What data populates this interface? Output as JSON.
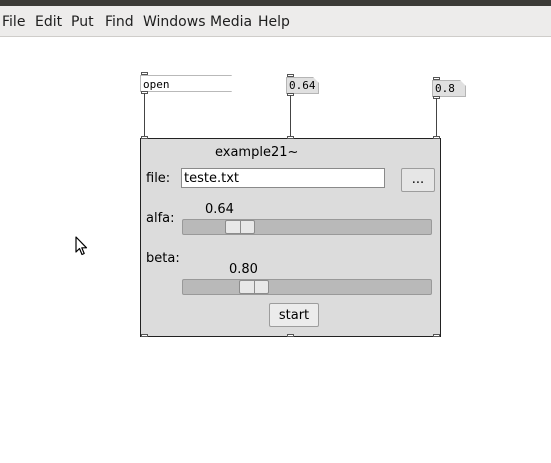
{
  "menubar": {
    "items": [
      "File",
      "Edit",
      "Put",
      "Find",
      "Windows",
      "Media",
      "Help"
    ]
  },
  "canvas": {
    "message_box": "open teste.txt",
    "number_box_1": "0.64",
    "number_box_2": "0.8"
  },
  "gop": {
    "title": "example21~",
    "file_label": "file:",
    "file_value": "teste.txt",
    "browse_label": "...",
    "alfa_label": "alfa:",
    "alfa_value_text": "0.64",
    "alfa_value": 0.64,
    "beta_label": "beta:",
    "beta_value_text": "0.80",
    "beta_value": 0.8,
    "start_label": "start"
  },
  "icons": {
    "cursor": "mouse-pointer-icon"
  },
  "colors": {
    "panel_background": "#dcdcdc",
    "slider_trough": "#b9b9b9",
    "menubar": "#edeceb"
  }
}
